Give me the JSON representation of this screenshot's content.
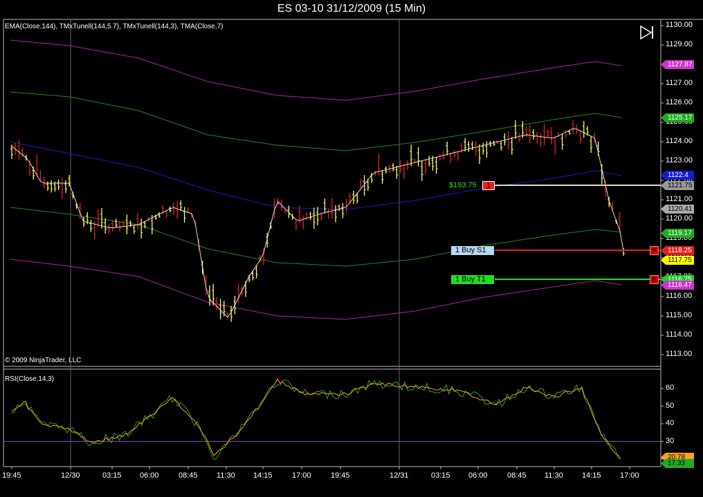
{
  "window": {
    "title": "ES 03-10  31/12/2009 (15 Min)"
  },
  "price_panel": {
    "indicator_label": "EMA(Close,144), TMxTunell(144,5.7), TMxTunell(144,3), TMA(Close,7)",
    "copyright": "© 2009 NinjaTrader, LLC",
    "y_ticks": [
      "1130.00",
      "1129.00",
      "1128.00",
      "1127.00",
      "1126.00",
      "1125.00",
      "1124.00",
      "1123.00",
      "1122.00",
      "1121.00",
      "1120.00",
      "1119.00",
      "1118.00",
      "1117.00",
      "1116.00",
      "1115.00",
      "1114.00",
      "1113.00"
    ],
    "price_labels": [
      {
        "value": "1127.87",
        "color": "#cc33cc"
      },
      {
        "value": "1125.17",
        "color": "#22aa22"
      },
      {
        "value": "1122.4",
        "color": "#1a1acc"
      },
      {
        "value": "1121.75",
        "color": "#999999"
      },
      {
        "value": "1120.41",
        "color": "#aaaaaa"
      },
      {
        "value": "1119.17",
        "color": "#22aa22"
      },
      {
        "value": "1118.25",
        "color": "#e02020"
      },
      {
        "value": "1117.75",
        "color": "#ffff00"
      },
      {
        "value": "1116.75",
        "color": "#22cc22"
      },
      {
        "value": "1116.47",
        "color": "#cc33cc"
      }
    ],
    "position": {
      "pnl": "$193.75",
      "qty": "1"
    },
    "orders": [
      {
        "qty_name": "1  Buy S1",
        "price": "1118.25"
      },
      {
        "qty_name": "1  Buy T1",
        "price": "1116.75"
      }
    ]
  },
  "rsi_panel": {
    "indicator_label": "RSI(Close,14,3)",
    "y_ticks": [
      "60",
      "50",
      "40",
      "30",
      "20"
    ],
    "value_labels": [
      {
        "value": "20.78",
        "color": "#ffa020"
      },
      {
        "value": "17.33",
        "color": "#22aa22"
      }
    ]
  },
  "x_axis": {
    "ticks": [
      "19:45",
      "12/30",
      "03:15",
      "06:00",
      "08:45",
      "11:30",
      "14:15",
      "17:00",
      "19:45",
      "12/31",
      "03:15",
      "06:00",
      "08:45",
      "11:30",
      "14:15",
      "17:00"
    ]
  },
  "colors": {
    "background": "#000000",
    "candle_up": "#ffff66",
    "candle_down": "#e02020",
    "ema": "#1a1acc",
    "tunnel_outer": "#aa22aa",
    "tunnel_inner": "#1e8a1e",
    "tma": "#dddddd",
    "rsi_line": "#22aa22",
    "rsi_avg": "#ffa020",
    "rsi_threshold": "#8844cc"
  },
  "icons": {
    "navigate": "skip-forward-icon"
  }
}
